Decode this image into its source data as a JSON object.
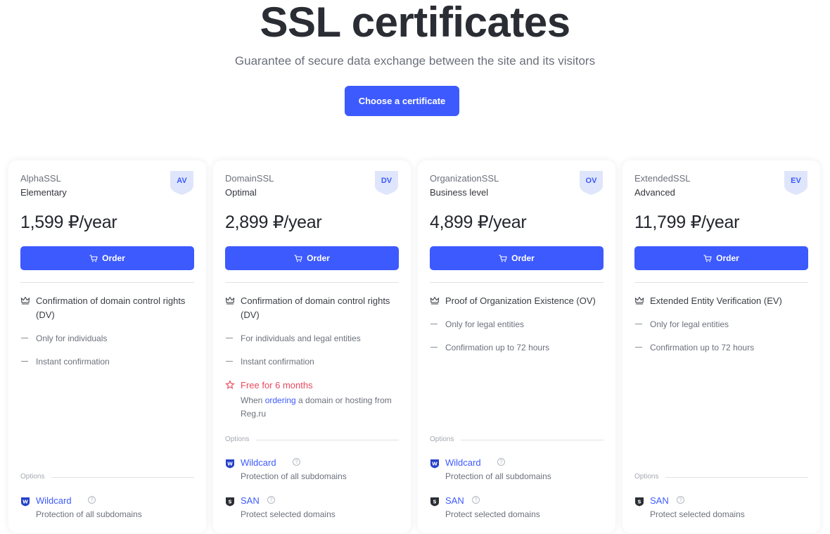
{
  "hero": {
    "title": "SSL certificates",
    "subtitle": "Guarantee of secure data exchange between the site and its visitors",
    "cta_label": "Choose a certificate"
  },
  "colors": {
    "accent": "#3d5afe",
    "promo": "#e8485e",
    "badge_bg": "#dfe6fb"
  },
  "common": {
    "order_label": "Order",
    "options_label": "Options",
    "order_icon": "cart-icon"
  },
  "cards": [
    {
      "name": "AlphaSSL",
      "level": "Elementary",
      "badge": "AV",
      "price": "1,599 ₽/year",
      "main_feature": "Confirmation of domain control rights (DV)",
      "features": [
        "Only for individuals",
        "Instant confirmation"
      ],
      "options": [
        {
          "title": "Wildcard",
          "desc": "Protection of all subdomains",
          "icon": "wildcard-shield-icon"
        }
      ]
    },
    {
      "name": "DomainSSL",
      "level": "Optimal",
      "badge": "DV",
      "price": "2,899 ₽/year",
      "main_feature": "Confirmation of domain control rights (DV)",
      "features": [
        "For individuals and legal entities",
        "Instant confirmation"
      ],
      "promo": {
        "title": "Free for 6 months",
        "note_before": "When ",
        "note_link": "ordering",
        "note_after": " a domain or hosting from Reg.ru"
      },
      "options": [
        {
          "title": "Wildcard",
          "desc": "Protection of all subdomains",
          "icon": "wildcard-shield-icon"
        },
        {
          "title": "SAN",
          "desc": "Protect selected domains",
          "icon": "san-shield-icon"
        }
      ]
    },
    {
      "name": "OrganizationSSL",
      "level": "Business level",
      "badge": "OV",
      "price": "4,899 ₽/year",
      "main_feature": "Proof of Organization Existence (OV)",
      "features": [
        "Only for legal entities",
        "Confirmation up to 72 hours"
      ],
      "options": [
        {
          "title": "Wildcard",
          "desc": "Protection of all subdomains",
          "icon": "wildcard-shield-icon"
        },
        {
          "title": "SAN",
          "desc": "Protect selected domains",
          "icon": "san-shield-icon"
        }
      ]
    },
    {
      "name": "ExtendedSSL",
      "level": "Advanced",
      "badge": "EV",
      "price": "11,799 ₽/year",
      "main_feature": "Extended Entity Verification (EV)",
      "features": [
        "Only for legal entities",
        "Confirmation up to 72 hours"
      ],
      "options": [
        {
          "title": "SAN",
          "desc": "Protect selected domains",
          "icon": "san-shield-icon"
        }
      ]
    }
  ]
}
